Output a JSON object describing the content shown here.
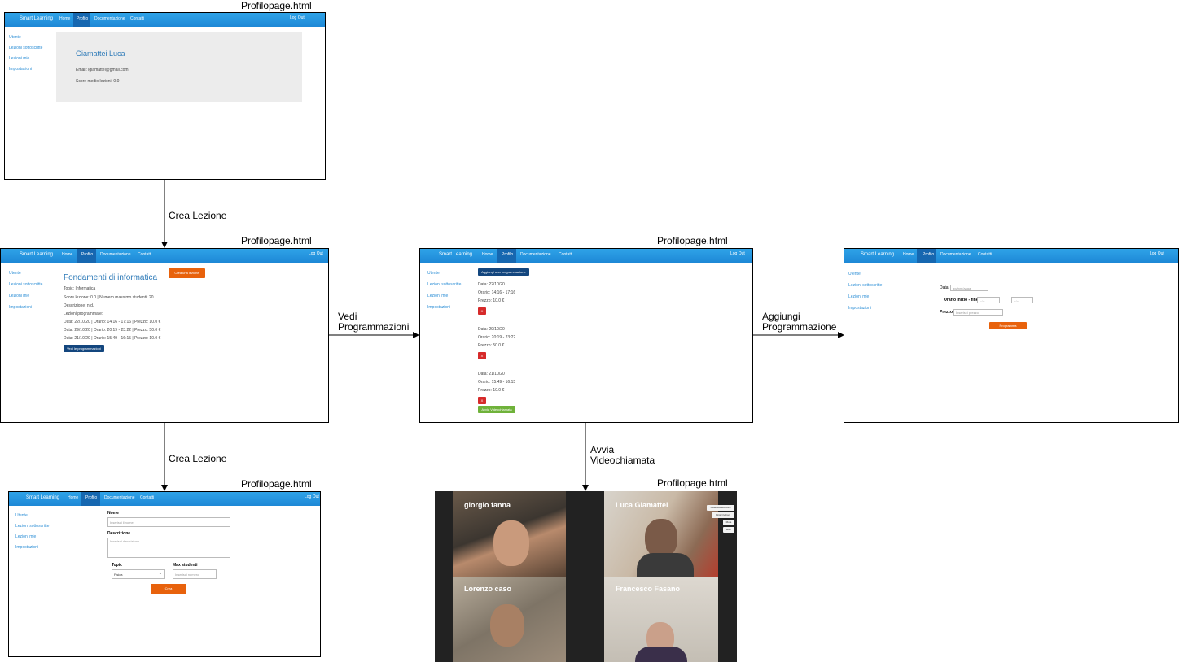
{
  "screen_title": "Profilopage.html",
  "nav": {
    "brand": "Smart Learning",
    "home": "Home",
    "profilo": "Profilo",
    "docs": "Documentazione",
    "contatti": "Contatti",
    "logout": "Log Out"
  },
  "sidebar": {
    "utente": "Utente",
    "lezioni_sottoscritte": "Lezioni sottoscritte",
    "lezioni_mie": "Lezioni mie",
    "impostazioni": "Impostazioni"
  },
  "arrows": {
    "crea_lezione_1": "Crea Lezione",
    "crea_lezione_2": "Crea Lezione",
    "vedi_programmazioni": "Vedi\nProgrammazioni",
    "aggiungi_programmazione": "Aggiungi\nProgrammazione",
    "avvia_videochiamata": "Avvia\nVideochiamata"
  },
  "profile": {
    "name": "Giamattei Luca",
    "email": "Email: lgiamattei@gmail.com",
    "score": "Score medio lezioni: 0.0"
  },
  "lesson": {
    "title": "Fondamenti di informatica",
    "create_button": "Crea una lezione",
    "topic": "Topic: Informatica",
    "score": "Score lezione: 0.0 | Numero massimo studenti: 20",
    "description": "Descrizione: n.d.",
    "scheduled_heading": "Lezioni programmate:",
    "schedules": [
      "Data: 22/10/20 | Orario: 14:16 - 17:16 | Prezzo: 10.0 €",
      "Data: 29/10/20 | Orario: 20:19 - 23:22 | Prezzo: 50.0 €",
      "Data: 21/10/20 | Orario: 15:49 - 16:15 | Prezzo: 10.0 €"
    ],
    "see_button": "Vedi le programmazioni"
  },
  "schedules_page": {
    "add_button": "Aggiungi una programmazione",
    "items": [
      {
        "date": "Data: 22/10/20",
        "time": "Orario: 14:16 - 17:16",
        "price": "Prezzo: 10.0 €"
      },
      {
        "date": "Data: 29/10/20",
        "time": "Orario: 20:19 - 23:22",
        "price": "Prezzo: 50.0 €"
      },
      {
        "date": "Data: 21/10/20",
        "time": "Orario: 15:49 - 16:15",
        "price": "Prezzo: 10.0 €"
      }
    ],
    "delete_label": "X",
    "start_call_button": "Avvia Videochiamata"
  },
  "add_schedule": {
    "data_label": "Data:",
    "date_placeholder": "gg/mm/aaaa",
    "orario_label": "Orario inizio - fine:",
    "time_placeholder": "--:--",
    "prezzo_label": "Prezzo:",
    "prezzo_placeholder": "Inserisci prezzo",
    "submit": "Programma"
  },
  "create_lesson": {
    "nome_label": "Nome",
    "nome_placeholder": "Inserisci il nome",
    "descr_label": "Descrizione",
    "descr_placeholder": "Inserisci descrizione",
    "topic_label": "Topic",
    "topic_value": "Fisica",
    "max_label": "Max studenti",
    "max_placeholder": "Inserisci numero",
    "submit": "Crea"
  },
  "videocall": {
    "participants": [
      "giorgio fanna",
      "Luca Giamattei",
      "Lorenzo caso",
      "Francesco Fasano"
    ],
    "controls": [
      "Disabilita Webcam",
      "Finisci lezioni",
      "Muta",
      "Esci"
    ]
  }
}
